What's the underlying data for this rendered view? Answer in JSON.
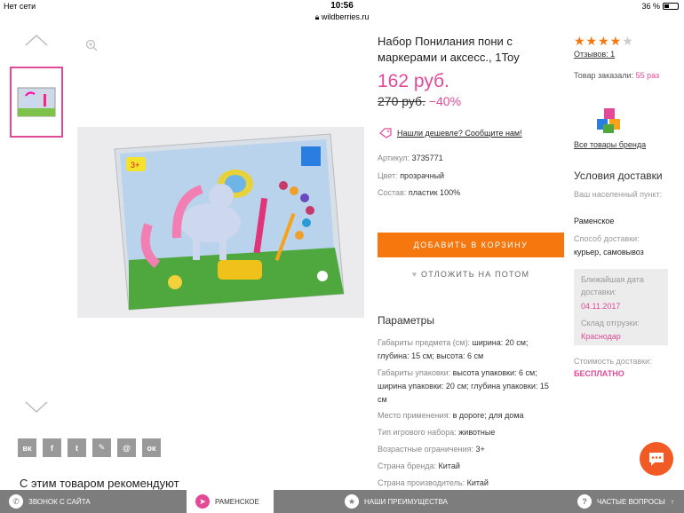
{
  "status": {
    "network": "Нет сети",
    "time": "10:56",
    "battery": "36 %"
  },
  "url": "wildberries.ru",
  "product": {
    "title": "Набор Понилания пони с маркерами и аксесс., 1Toy",
    "price": "162 руб.",
    "old_price": "270 руб.",
    "discount": "−40%",
    "cheaper_text": "Нашли дешевле? Сообщите нам!",
    "article_label": "Артикул:",
    "article_value": "3735771",
    "color_label": "Цвет:",
    "color_value": "прозрачный",
    "composition_label": "Состав:",
    "composition_value": "пластик 100%",
    "add_to_cart": "ДОБАВИТЬ В КОРЗИНУ",
    "save_later": "ОТЛОЖИТЬ НА ПОТОМ",
    "rating": 4,
    "reviews": "Отзывов: 1",
    "ordered_label": "Товар заказали:",
    "ordered_value": "55 раз",
    "brand_link": "Все товары бренда",
    "recommend": "С этим товаром рекомендуют"
  },
  "params": {
    "heading": "Параметры",
    "items": [
      {
        "label": "Габариты предмета (см):",
        "value": "ширина: 20 см; глубина: 15 см; высота: 6 см"
      },
      {
        "label": "Габариты упаковки:",
        "value": "высота упаковки: 6 см; ширина упаковки: 20 см; глубина упаковки: 15 см"
      },
      {
        "label": "Место применения:",
        "value": "в дороге; для дома"
      },
      {
        "label": "Тип игрового набора:",
        "value": "животные"
      },
      {
        "label": "Возрастные ограничения:",
        "value": "3+"
      },
      {
        "label": "Страна бренда:",
        "value": "Китай"
      },
      {
        "label": "Страна производитель:",
        "value": "Китай"
      }
    ]
  },
  "delivery": {
    "heading": "Условия доставки",
    "city_label": "Ваш населенный пункт:",
    "city_value": "Раменское",
    "method_label": "Способ доставки:",
    "method_value": "курьер, самовывоз",
    "date_label": "Ближайшая дата доставки:",
    "date_value": "04.11.2017",
    "warehouse_label": "Склад отгрузки:",
    "warehouse_value": "Краснодар",
    "cost_label": "Стоимость доставки:",
    "cost_value": "БЕСПЛАТНО"
  },
  "socials": [
    "вк",
    "f",
    "t",
    "✎",
    "@",
    "ок"
  ],
  "bottombar": {
    "call": "ЗВОНОК С САЙТА",
    "location": "РАМЕНСКОЕ",
    "benefits": "НАШИ ПРЕИМУЩЕСТВА",
    "faq": "ЧАСТЫЕ ВОПРОСЫ"
  },
  "colors": {
    "accent": "#e24a97",
    "button": "#f7770f",
    "chat": "#f15a24"
  }
}
